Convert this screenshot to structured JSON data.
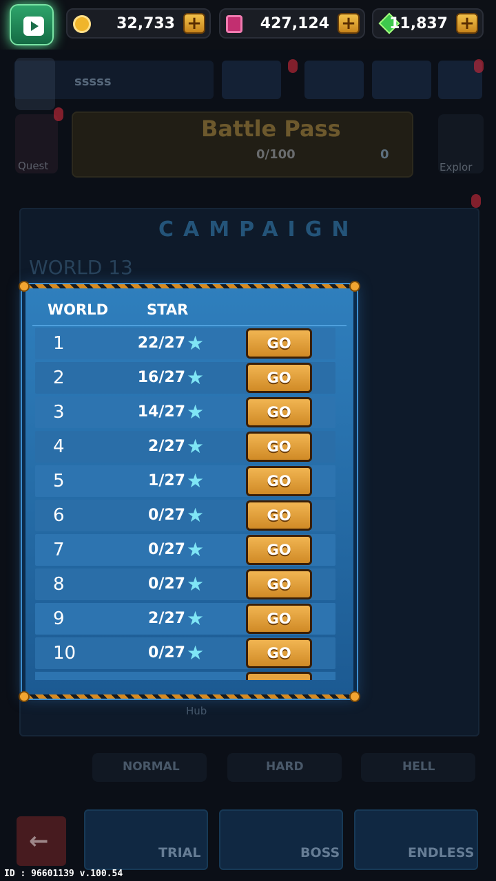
{
  "topbar": {
    "resources": [
      {
        "icon": "coin-icon",
        "value": "32,733",
        "add_label": "+"
      },
      {
        "icon": "gem-icon",
        "value": "427,124",
        "add_label": "+"
      },
      {
        "icon": "diamond-icon",
        "value": "11,837",
        "add_label": "+"
      }
    ]
  },
  "background": {
    "player_name": "sssss",
    "quest_label": "Quest",
    "battle_pass": {
      "title": "Battle Pass",
      "progress": "0/100",
      "level": "0"
    },
    "explore_label": "Explor",
    "campaign_title": "CAMPAIGN",
    "world_title": "WORLD 13",
    "hub_label": "Hub",
    "modes": [
      "NORMAL",
      "HARD",
      "HELL"
    ],
    "bottom_buttons": [
      "TRIAL",
      "BOSS",
      "ENDLESS"
    ],
    "back_label": "←"
  },
  "modal": {
    "header_world": "WORLD",
    "header_star": "STAR",
    "go_label": "GO",
    "rows": [
      {
        "world": "1",
        "stars": "22/27"
      },
      {
        "world": "2",
        "stars": "16/27"
      },
      {
        "world": "3",
        "stars": "14/27"
      },
      {
        "world": "4",
        "stars": "2/27"
      },
      {
        "world": "5",
        "stars": "1/27"
      },
      {
        "world": "6",
        "stars": "0/27"
      },
      {
        "world": "7",
        "stars": "0/27"
      },
      {
        "world": "8",
        "stars": "0/27"
      },
      {
        "world": "9",
        "stars": "2/27"
      },
      {
        "world": "10",
        "stars": "0/27"
      }
    ]
  },
  "footer": {
    "id_text": "ID : 96601139 v.100.54"
  }
}
